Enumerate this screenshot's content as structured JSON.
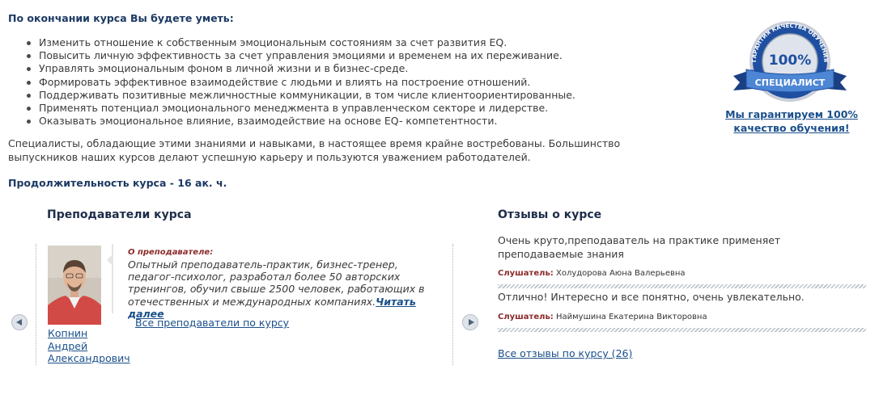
{
  "outcomes": {
    "heading": "По окончании курса Вы будете уметь:",
    "skills": [
      "Изменить отношение к собственным эмоциональным состояниям за счет развития EQ.",
      "Повысить личную эффективность за счет управления эмоциями и временем на их переживание.",
      "Управлять эмоциональным фоном в личной жизни и в бизнес-среде.",
      "Формировать эффективное взаимодействие с людьми и влиять на построение отношений.",
      "Поддерживать позитивные межличностные коммуникации, в том числе клиентоориентированные.",
      "Применять потенциал эмоционального менеджмента в управленческом секторе и лидерстве.",
      "Оказывать эмоциональное влияние, взаимодействие на основе EQ- компетентности."
    ],
    "note": "Специалисты, обладающие этими знаниями и навыками, в настоящее время крайне востребованы. Большинство выпускников наших курсов делают успешную карьеру и пользуются уважением работодателей.",
    "duration": "Продолжительность курса - 16 ак. ч."
  },
  "badge": {
    "arc_text": "ГАРАНТИЯ КАЧЕСТВА ОБУЧЕНИЯ",
    "percent": "100%",
    "ribbon": "СПЕЦИАЛИСТ",
    "guarantee_line1": "Мы гарантируем 100%",
    "guarantee_line2": "качество обучения!",
    "colors": {
      "blue": "#1f4fa1",
      "light_blue": "#4d86d4",
      "silver": "#c9ced8"
    }
  },
  "teachers": {
    "title": "Преподаватели курса",
    "name_lines": [
      "Копнин",
      "Андрей",
      "Александрович"
    ],
    "bio_label": "О преподавателе:",
    "bio_text": "Опытный преподаватель-практик, бизнес-тренер, педагог-психолог, разработал более 50 авторских тренингов, обучил свыше 2500 человек, работающих в отечественных и международных компаниях.",
    "read_more": "Читать далее",
    "all_link": "Все преподаватели по курсу"
  },
  "reviews": {
    "title": "Отзывы о курсе",
    "listener_label": "Слушатель:",
    "items": [
      {
        "text": "Очень круто,преподаватель на практике применяет преподаваемые знания",
        "author": "Холудорова Аюна Валерьевна"
      },
      {
        "text": "Отлично! Интересно и все понятно, очень увлекательно.",
        "author": "Наймушина Екатерина Викторовна"
      }
    ],
    "all_link": "Все отзывы по курсу (26)"
  },
  "icons": {
    "prev": "chevron-left-icon",
    "next": "chevron-right-icon"
  }
}
